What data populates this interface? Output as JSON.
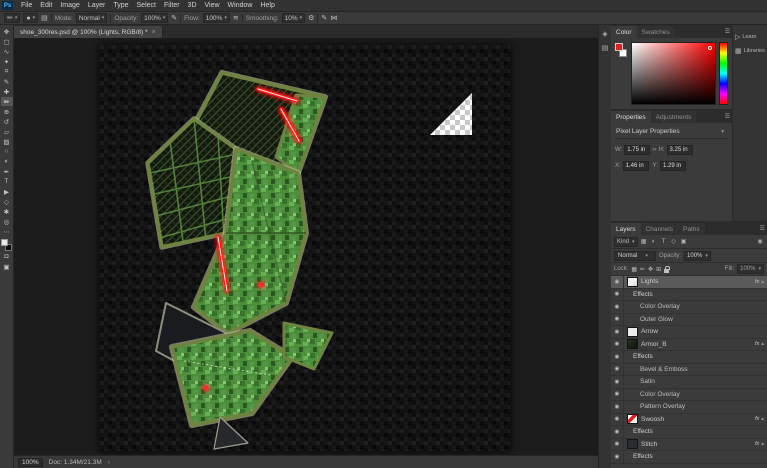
{
  "app": {
    "logo_text": "Ps"
  },
  "menubar": {
    "items": [
      "File",
      "Edit",
      "Image",
      "Layer",
      "Type",
      "Select",
      "Filter",
      "3D",
      "View",
      "Window",
      "Help"
    ]
  },
  "options": {
    "mode_label": "Mode:",
    "mode_value": "Normal",
    "opacity_label": "Opacity:",
    "opacity_value": "100%",
    "flow_label": "Flow:",
    "flow_value": "100%",
    "smoothing_label": "Smoothing:",
    "smoothing_value": "10%"
  },
  "tab": {
    "title": "shoe_300res.psd @ 100% (Lights, RGB/8) *"
  },
  "toolbar": {
    "tools": [
      {
        "name": "move-tool",
        "glyph": "✥"
      },
      {
        "name": "rectangular-marquee-tool",
        "glyph": "▢"
      },
      {
        "name": "lasso-tool",
        "glyph": "∿"
      },
      {
        "name": "quick-selection-tool",
        "glyph": "✦"
      },
      {
        "name": "crop-tool",
        "glyph": "⌗"
      },
      {
        "name": "eyedropper-tool",
        "glyph": "✎"
      },
      {
        "name": "healing-brush-tool",
        "glyph": "✚"
      },
      {
        "name": "brush-tool",
        "glyph": "✏"
      },
      {
        "name": "clone-stamp-tool",
        "glyph": "⊕"
      },
      {
        "name": "history-brush-tool",
        "glyph": "↺"
      },
      {
        "name": "eraser-tool",
        "glyph": "▱"
      },
      {
        "name": "gradient-tool",
        "glyph": "▨"
      },
      {
        "name": "blur-tool",
        "glyph": "○"
      },
      {
        "name": "dodge-tool",
        "glyph": "◐"
      },
      {
        "name": "pen-tool",
        "glyph": "✒"
      },
      {
        "name": "type-tool",
        "glyph": "T"
      },
      {
        "name": "path-selection-tool",
        "glyph": "▶"
      },
      {
        "name": "shape-tool",
        "glyph": "◇"
      },
      {
        "name": "hand-tool",
        "glyph": "✱"
      },
      {
        "name": "zoom-tool",
        "glyph": "◎"
      }
    ],
    "more_glyph": "⋯",
    "quickmask_glyph": "◘",
    "screenmode_glyph": "▣"
  },
  "dock_icons": [
    {
      "name": "history-panel-icon",
      "glyph": "◈"
    },
    {
      "name": "brush-settings-panel-icon",
      "glyph": "▤"
    }
  ],
  "color_panel": {
    "tab_color": "Color",
    "tab_swatches": "Swatches"
  },
  "mini_dock": {
    "items": [
      {
        "label": "Learn",
        "glyph": "▷"
      },
      {
        "label": "Libraries",
        "glyph": "▦"
      }
    ]
  },
  "properties": {
    "tab": "Properties",
    "tab2": "Adjustments",
    "section": "Pixel Layer Properties",
    "w_label": "W:",
    "w_value": "1.75 in",
    "h_label": "H:",
    "h_value": "3.25 in",
    "x_label": "X:",
    "x_value": "1.46 in",
    "y_label": "Y:",
    "y_value": "1.29 in"
  },
  "layers": {
    "tab_layers": "Layers",
    "tab_channels": "Channels",
    "tab_paths": "Paths",
    "kind_label": "Kind",
    "filter_icons": [
      {
        "name": "pixel-layer-filter-icon",
        "glyph": "▦"
      },
      {
        "name": "adjustment-layer-filter-icon",
        "glyph": "◐"
      },
      {
        "name": "type-layer-filter-icon",
        "glyph": "T"
      },
      {
        "name": "shape-layer-filter-icon",
        "glyph": "◇"
      },
      {
        "name": "smart-object-filter-icon",
        "glyph": "▣"
      }
    ],
    "blend_mode": "Normal",
    "opacity_label": "Opacity:",
    "opacity_value": "100%",
    "lock_label": "Lock:",
    "fill_label": "Fill:",
    "fill_value": "100%",
    "rows": [
      {
        "name": "Lights"
      },
      {
        "name": "Effects"
      },
      {
        "name": "Color Overlay"
      },
      {
        "name": "Outer Glow"
      },
      {
        "name": "Arrow"
      },
      {
        "name": "Armor_B"
      },
      {
        "name": "Effects"
      },
      {
        "name": "Bevel & Emboss"
      },
      {
        "name": "Satin"
      },
      {
        "name": "Color Overlay"
      },
      {
        "name": "Pattern Overlay"
      },
      {
        "name": "Swoosh"
      },
      {
        "name": "Effects"
      },
      {
        "name": "Stitch"
      },
      {
        "name": "Effects"
      }
    ]
  },
  "status": {
    "zoom": "100%",
    "doc": "Doc: 1.34M/21.3M",
    "arrow": "›"
  },
  "glyphs": {
    "eye": "◉",
    "dd": "▾",
    "up": "▴",
    "menu": "☰",
    "fx": "fx",
    "link": "∞",
    "gear": "⚙",
    "brush": "✏",
    "panel": "▤",
    "pressure": "✎",
    "airbrush": "≋",
    "symmetry": "⋈",
    "dot": "●",
    "toggle": "◉",
    "close": "×",
    "lock_checker": "▦",
    "lock_brush": "✏",
    "lock_move": "✥",
    "lock_board": "⊞"
  },
  "colors": {
    "accent": "#4db8ff",
    "laser_red": "#ff1616",
    "camo_green": "#4c8f3b"
  }
}
